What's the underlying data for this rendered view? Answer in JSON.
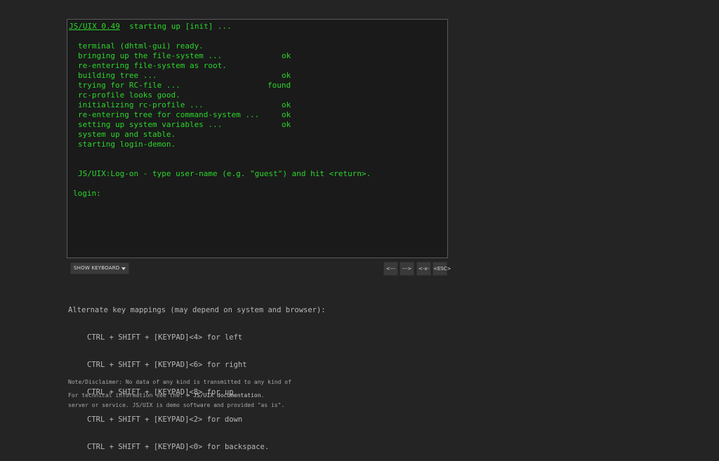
{
  "terminal": {
    "brand": "JS/UIX 0.49",
    "header_suffix": "  starting up [init] ...",
    "boot_lines": [
      {
        "text": "terminal (dhtml-gui) ready.",
        "status": ""
      },
      {
        "text": "bringing up the file-system ...",
        "status": "ok"
      },
      {
        "text": "re-entering file-system as root.",
        "status": ""
      },
      {
        "text": "building tree ...",
        "status": "ok"
      },
      {
        "text": "trying for RC-file ...",
        "status": "found"
      },
      {
        "text": "rc-profile looks good.",
        "status": ""
      },
      {
        "text": "initializing rc-profile ...",
        "status": "ok"
      },
      {
        "text": "re-entering tree for command-system ...",
        "status": "ok"
      },
      {
        "text": "setting up system variables ...",
        "status": "ok"
      },
      {
        "text": "system up and stable.",
        "status": ""
      },
      {
        "text": "starting login-demon.",
        "status": ""
      }
    ],
    "logon_message": "JS/UIX:Log-on - type user-name (e.g. \"guest\") and hit <return>.",
    "login_prompt": "login:"
  },
  "controls": {
    "show_keyboard": "SHOW KEYBOARD",
    "nav_left": "<---",
    "nav_right": "--->",
    "nav_backspace": "<-x-",
    "nav_esc": "<ESC>"
  },
  "mappings": {
    "title": "Alternate key mappings (may depend on system and browser):",
    "lines": [
      "CTRL + SHIFT + [KEYPAD]<4> for left",
      "CTRL + SHIFT + [KEYPAD]<6> for right",
      "CTRL + SHIFT + [KEYPAD]<8> for up",
      "CTRL + SHIFT + [KEYPAD]<2> for down",
      "CTRL + SHIFT + [KEYPAD]<0> for backspace."
    ]
  },
  "disclaimer": {
    "line1": "Note/Disclaimer: No data of any kind is transmitted to any kind of",
    "line2": "server or service. JS/UIX is demo software and provided \"as is\"."
  },
  "tech_info": {
    "prefix": "For technical information see the: ",
    "link": "> JS/UIX documentation",
    "suffix": "."
  }
}
